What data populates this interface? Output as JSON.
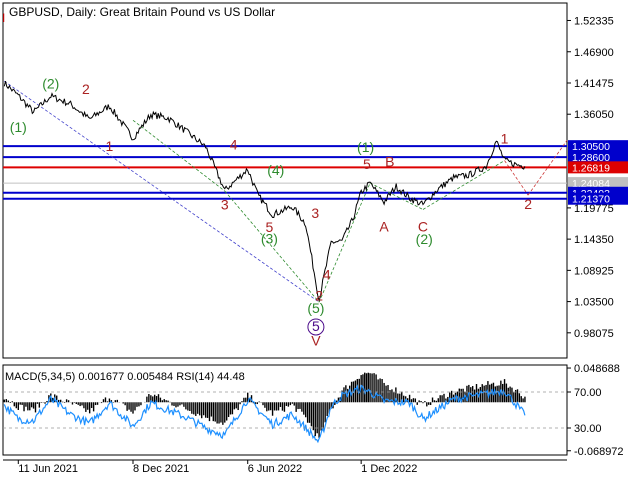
{
  "chart_data": {
    "type": "line",
    "title": "GBPUSD, Daily:  Great Britain Pound vs US Dollar",
    "corner_mark": "I",
    "main": {
      "ylim": [
        0.937,
        1.5537
      ],
      "y_ticks": [
        "1.52335",
        "1.46900",
        "1.41475",
        "1.36050",
        "1.19775",
        "1.14350",
        "1.08925",
        "1.03500",
        "0.98075"
      ],
      "series_name": "GBPUSD",
      "x": [
        "2021-05-20",
        "2021-06-11",
        "2021-07-05",
        "2021-08-01",
        "2021-09-01",
        "2021-10-01",
        "2021-11-01",
        "2021-12-08",
        "2022-01-05",
        "2022-02-01",
        "2022-03-01",
        "2022-04-01",
        "2022-05-01",
        "2022-06-06",
        "2022-06-22",
        "2022-07-15",
        "2022-08-15",
        "2022-09-05",
        "2022-09-26",
        "2022-10-15",
        "2022-11-01",
        "2022-11-18",
        "2022-12-01",
        "2022-12-15",
        "2023-01-06",
        "2023-01-25",
        "2023-02-15",
        "2023-03-08",
        "2023-03-31",
        "2023-04-25",
        "2023-05-20",
        "2023-06-15",
        "2023-07-01",
        "2023-07-14",
        "2023-08-01",
        "2023-08-15"
      ],
      "y": [
        1.415,
        1.393,
        1.364,
        1.392,
        1.378,
        1.352,
        1.375,
        1.319,
        1.36,
        1.354,
        1.331,
        1.304,
        1.228,
        1.265,
        1.22,
        1.186,
        1.2,
        1.17,
        1.038,
        1.138,
        1.14,
        1.178,
        1.225,
        1.241,
        1.208,
        1.235,
        1.215,
        1.203,
        1.23,
        1.25,
        1.255,
        1.27,
        1.314,
        1.28,
        1.273,
        1.27
      ],
      "levels": [
        {
          "label": "1.30500",
          "value": 1.305,
          "color": "#0000cc",
          "bg": "#0000cc",
          "fg": "#ffffff"
        },
        {
          "label": "1.28600",
          "value": 1.286,
          "color": "#0000cc",
          "bg": "#0000cc",
          "fg": "#ffffff"
        },
        {
          "label": "1.26819",
          "value": 1.26819,
          "color": "#dd0000",
          "bg": "#dd0000",
          "fg": "#ffffff"
        },
        {
          "label": "1.24084",
          "value": 1.24084,
          "color": "#c0c0c0",
          "bg": "#c0c0c0",
          "fg": "#ffffff"
        },
        {
          "label": "1.22403",
          "value": 1.22403,
          "color": "#0000cc",
          "bg": "#0000cc",
          "fg": "#ffffff"
        },
        {
          "label": "1.21370",
          "value": 1.2137,
          "color": "#0000cc",
          "bg": "#0000cc",
          "fg": "#ffffff"
        }
      ],
      "guides": [
        {
          "from": [
            "2021-05-20",
            1.418
          ],
          "to": [
            "2022-09-26",
            1.034
          ],
          "color": "#4444cc"
        },
        {
          "from": [
            "2021-12-08",
            1.35
          ],
          "to": [
            "2022-05-01",
            1.227
          ],
          "color": "#2e8b2e"
        },
        {
          "from": [
            "2022-05-01",
            1.227
          ],
          "to": [
            "2022-09-26",
            1.034
          ],
          "color": "#2e8b2e"
        },
        {
          "from": [
            "2022-09-26",
            1.034
          ],
          "to": [
            "2022-12-15",
            1.241
          ],
          "color": "#2e8b2e"
        },
        {
          "from": [
            "2022-12-15",
            1.241
          ],
          "to": [
            "2023-03-08",
            1.195
          ],
          "color": "#2e8b2e"
        },
        {
          "from": [
            "2023-03-08",
            1.195
          ],
          "to": [
            "2023-07-14",
            1.28
          ],
          "color": "#2e8b2e"
        },
        {
          "from": [
            "2023-07-14",
            1.28
          ],
          "to": [
            "2023-08-20",
            1.22
          ],
          "color": "#cc3333"
        },
        {
          "from": [
            "2023-08-20",
            1.22
          ],
          "to": [
            "2023-10-20",
            1.315
          ],
          "color": "#cc3333"
        }
      ],
      "wave_labels": [
        {
          "text": "(1)",
          "x": "2021-06-11",
          "y": 1.33,
          "color": "#2e8b2e"
        },
        {
          "text": "(2)",
          "x": "2021-08-01",
          "y": 1.405,
          "color": "#2e8b2e"
        },
        {
          "text": "2",
          "x": "2021-09-25",
          "y": 1.396,
          "color": "#aa2222"
        },
        {
          "text": "1",
          "x": "2021-11-01",
          "y": 1.297,
          "color": "#aa2222"
        },
        {
          "text": "4",
          "x": "2022-05-15",
          "y": 1.299,
          "color": "#aa2222"
        },
        {
          "text": "3",
          "x": "2022-05-01",
          "y": 1.195,
          "color": "#aa2222"
        },
        {
          "text": "5",
          "x": "2022-07-10",
          "y": 1.156,
          "color": "#aa2222"
        },
        {
          "text": "(3)",
          "x": "2022-07-10",
          "y": 1.136,
          "color": "#2e8b2e"
        },
        {
          "text": "(4)",
          "x": "2022-07-20",
          "y": 1.255,
          "color": "#2e8b2e"
        },
        {
          "text": "3",
          "x": "2022-09-20",
          "y": 1.18,
          "color": "#aa2222"
        },
        {
          "text": "4",
          "x": "2022-10-08",
          "y": 1.073,
          "color": "#aa2222"
        },
        {
          "text": "2",
          "x": "2022-09-26",
          "y": 1.037,
          "color": "#aa2222"
        },
        {
          "text": "(5)",
          "x": "2022-09-21",
          "y": 1.015,
          "color": "#2e8b2e"
        },
        {
          "text": "5",
          "x": "2022-09-21",
          "y": 0.984,
          "color": "#4a0a8a"
        },
        {
          "text": "V",
          "x": "2022-09-21",
          "y": 0.959,
          "color": "#aa2222"
        },
        {
          "text": "(1)",
          "x": "2022-12-08",
          "y": 1.295,
          "color": "#2e8b2e"
        },
        {
          "text": "5",
          "x": "2022-12-10",
          "y": 1.265,
          "color": "#aa2222"
        },
        {
          "text": "B",
          "x": "2023-01-15",
          "y": 1.27,
          "color": "#aa2222"
        },
        {
          "text": "A",
          "x": "2023-01-06",
          "y": 1.157,
          "color": "#aa2222"
        },
        {
          "text": "C",
          "x": "2023-03-08",
          "y": 1.157,
          "color": "#aa2222"
        },
        {
          "text": "(2)",
          "x": "2023-03-10",
          "y": 1.135,
          "color": "#2e8b2e"
        },
        {
          "text": "1",
          "x": "2023-07-14",
          "y": 1.31,
          "color": "#aa2222"
        },
        {
          "text": "2",
          "x": "2023-08-20",
          "y": 1.196,
          "color": "#aa2222"
        }
      ]
    },
    "indicator": {
      "label": "MACD(5,34,5) 0.001677 0.005484 RSI(14) 44.48",
      "ylim": [
        -0.075,
        0.053
      ],
      "y_ticks": [
        "0.048688",
        "70.00",
        "30.00",
        "-0.068972"
      ],
      "macd_x": [
        "2021-05-20",
        "2021-06-11",
        "2021-07-05",
        "2021-08-01",
        "2021-09-01",
        "2021-10-01",
        "2021-11-01",
        "2021-12-08",
        "2022-01-05",
        "2022-02-01",
        "2022-03-01",
        "2022-04-01",
        "2022-05-01",
        "2022-06-06",
        "2022-07-15",
        "2022-08-15",
        "2022-09-05",
        "2022-09-26",
        "2022-10-15",
        "2022-11-01",
        "2022-12-01",
        "2022-12-15",
        "2023-01-06",
        "2023-02-15",
        "2023-03-08",
        "2023-04-25",
        "2023-06-15",
        "2023-07-14",
        "2023-08-15"
      ],
      "macd_values": [
        0.008,
        -0.006,
        -0.012,
        0.01,
        -0.002,
        -0.014,
        0.008,
        -0.015,
        0.012,
        0.001,
        -0.009,
        -0.021,
        -0.03,
        0.009,
        -0.016,
        -0.004,
        -0.022,
        -0.052,
        -0.01,
        0.016,
        0.04,
        0.042,
        0.026,
        0.008,
        -0.004,
        0.015,
        0.025,
        0.028,
        0.008
      ],
      "rsi_x": [
        "2021-05-20",
        "2021-06-11",
        "2021-07-05",
        "2021-08-01",
        "2021-09-01",
        "2021-10-01",
        "2021-11-01",
        "2021-12-08",
        "2022-01-05",
        "2022-02-01",
        "2022-03-01",
        "2022-04-01",
        "2022-05-01",
        "2022-06-06",
        "2022-07-15",
        "2022-08-15",
        "2022-09-05",
        "2022-09-26",
        "2022-10-15",
        "2022-11-01",
        "2022-12-01",
        "2022-12-15",
        "2023-01-06",
        "2023-02-15",
        "2023-03-08",
        "2023-04-25",
        "2023-06-15",
        "2023-07-14",
        "2023-08-15"
      ],
      "rsi_values": [
        55,
        40,
        38,
        62,
        45,
        35,
        58,
        32,
        58,
        50,
        42,
        30,
        22,
        62,
        34,
        45,
        30,
        14,
        54,
        66,
        74,
        70,
        60,
        58,
        40,
        62,
        68,
        72,
        44
      ]
    },
    "x_ticks": [
      {
        "label": "11 Jun 2021",
        "x": "2021-06-11"
      },
      {
        "label": "8 Dec 2021",
        "x": "2021-12-08"
      },
      {
        "label": "6 Jun 2022",
        "x": "2022-06-06"
      },
      {
        "label": "1 Dec 2022",
        "x": "2022-12-01"
      }
    ],
    "xlim": [
      "2021-05-18",
      "2023-10-20"
    ],
    "colors": {
      "price": "#000000",
      "macd_hist": "#000000",
      "rsi": "#1e90ff",
      "axis": "#000000",
      "text": "#000000"
    }
  }
}
